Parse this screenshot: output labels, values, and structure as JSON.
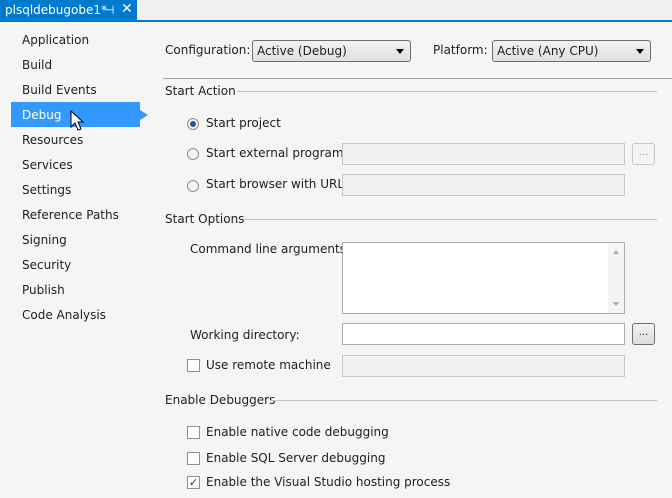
{
  "tab": {
    "title": "plsqldebugobe1*",
    "pin": "⊣",
    "close": "✕"
  },
  "sidebar": {
    "items": [
      "Application",
      "Build",
      "Build Events",
      "Debug",
      "Resources",
      "Services",
      "Settings",
      "Reference Paths",
      "Signing",
      "Security",
      "Publish",
      "Code Analysis"
    ],
    "selected": "Debug"
  },
  "config": {
    "label": "Configuration:",
    "value": "Active (Debug)",
    "platform_label": "Platform:",
    "platform_value": "Active (Any CPU)"
  },
  "start_action": {
    "title": "Start Action",
    "options": [
      "Start project",
      "Start external program:",
      "Start browser with URL:"
    ],
    "selected": "Start project",
    "browse": "..."
  },
  "start_options": {
    "title": "Start Options",
    "cmd_label": "Command line arguments:",
    "cmd_value": "",
    "workdir_label": "Working directory:",
    "workdir_value": "",
    "browse": "...",
    "remote_label": "Use remote machine",
    "remote_checked": false
  },
  "debuggers": {
    "title": "Enable Debuggers",
    "items": [
      {
        "label": "Enable native code debugging",
        "checked": false
      },
      {
        "label": "Enable SQL Server debugging",
        "checked": false
      },
      {
        "label": "Enable the Visual Studio hosting process",
        "checked": true
      }
    ]
  }
}
